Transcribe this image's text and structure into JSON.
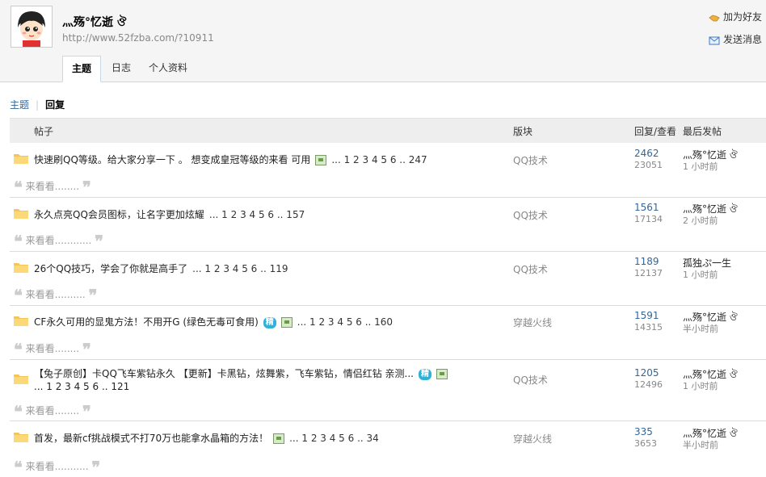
{
  "profile": {
    "name": "灬殇°忆逝 ঔ",
    "url": "http://www.52fzba.com/?10911",
    "avatar_icon": "cartoon-avatar-icon"
  },
  "actions": {
    "add_friend": "加为好友",
    "send_message": "发送消息"
  },
  "tabs": [
    "主题",
    "日志",
    "个人资料"
  ],
  "subnav": {
    "topics": "主题",
    "separator": "|",
    "replies": "回复"
  },
  "table_headers": {
    "post": "帖子",
    "forum": "版块",
    "reply_view": "回复/查看",
    "last_post": "最后发帖"
  },
  "rows": [
    {
      "title": "快速刷QQ等级。给大家分享一下 。 想变成皇冠等级的来看 可用",
      "badge": "",
      "pages": "... 1 2 3 4 5 6 .. 247",
      "quote": "来看看........",
      "forum": "QQ技术",
      "replies": "2462",
      "views": "23051",
      "last_user": "灬殇°忆逝 ঔ",
      "last_time": "1 小时前"
    },
    {
      "title": "永久点亮QQ会员图标，让名字更加炫耀",
      "badge": "",
      "pages": "... 1 2 3 4 5 6 .. 157",
      "quote": "来看看............",
      "forum": "QQ技术",
      "replies": "1561",
      "views": "17134",
      "last_user": "灬殇°忆逝 ঔ",
      "last_time": "2 小时前"
    },
    {
      "title": "26个QQ技巧，学会了你就是高手了",
      "badge": "",
      "pages": "... 1 2 3 4 5 6 .. 119",
      "quote": "来看看..........",
      "forum": "QQ技术",
      "replies": "1189",
      "views": "12137",
      "last_user": "孤独ぷ一生",
      "last_time": "1 小时前"
    },
    {
      "title": "CF永久可用的显鬼方法！不用开G (绿色无毒可食用)",
      "badge": "精",
      "pages": "... 1 2 3 4 5 6 .. 160",
      "quote": "来看看........",
      "forum": "穿越火线",
      "replies": "1591",
      "views": "14315",
      "last_user": "灬殇°忆逝 ঔ",
      "last_time": "半小时前"
    },
    {
      "title": "【兔子原创】卡QQ飞车紫钻永久 【更新】卡黑钻，炫舞紫，飞车紫钻，情侣红钻 亲测...",
      "badge": "精",
      "pages": "... 1 2 3 4 5 6 .. 121",
      "quote": "来看看........",
      "forum": "QQ技术",
      "replies": "1205",
      "views": "12496",
      "last_user": "灬殇°忆逝 ঔ",
      "last_time": "1 小时前"
    },
    {
      "title": "首发，最新cf挑战模式不打70万也能拿水晶箱的方法！",
      "badge": "",
      "pages": "... 1 2 3 4 5 6 .. 34",
      "quote": "来看看...........",
      "forum": "穿越火线",
      "replies": "335",
      "views": "3653",
      "last_user": "灬殇°忆逝 ঔ",
      "last_time": "半小时前"
    }
  ]
}
